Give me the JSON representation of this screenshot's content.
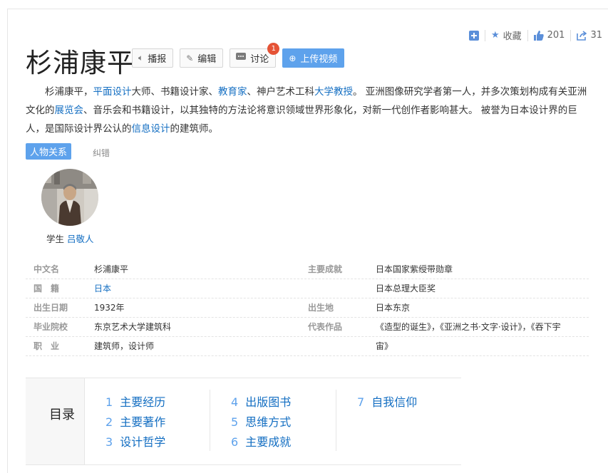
{
  "actions": {
    "collect_label": "收藏",
    "like_count": "201",
    "share_count": "31"
  },
  "title": "杉浦康平",
  "buttons": {
    "report": "播报",
    "edit": "编辑",
    "discuss": "讨论",
    "discuss_badge": "1",
    "upload": "上传视频"
  },
  "summary": {
    "p1": "杉浦康平，",
    "link1": "平面设计",
    "p2": "大师、书籍设计家、",
    "link2": "教育家",
    "p3": "、神户艺术工科",
    "link3": "大学教授",
    "p4": "。 亚洲图像研究学者第一人，并多次策划构成有关亚洲文化的",
    "link4": "展览会",
    "p5": "、音乐会和书籍设计，以其独特的方法论将意识领域世界形象化，对新一代创作者影响甚大。 被誉为日本设计界的巨人，是国际设计界公认的",
    "link5": "信息设计",
    "p6": "的建筑师。"
  },
  "relations": {
    "tab_label": "人物关系",
    "correct_label": "纠错",
    "person_role": "学生",
    "person_name": "吕敬人"
  },
  "info": {
    "rows": [
      {
        "k1": "中文名",
        "v1": "杉浦康平",
        "k2": "主要成就",
        "v2": "日本国家紫绶带勋章"
      },
      {
        "k1": "国　籍",
        "v1": "日本",
        "k2": "",
        "v2": "日本总理大臣奖"
      },
      {
        "k1": "出生日期",
        "v1": "1932年",
        "k2": "出生地",
        "v2": "日本东京"
      },
      {
        "k1": "毕业院校",
        "v1": "东京艺术大学建筑科",
        "k2": "代表作品",
        "v2": "《造型的诞生》，《亚洲之书·文字·设计》，《吞下宇"
      },
      {
        "k1": "职　业",
        "v1": "建筑师，设计师",
        "k2": "",
        "v2": "宙》"
      }
    ]
  },
  "toc": {
    "title": "目录",
    "items": [
      {
        "num": "1",
        "label": "主要经历"
      },
      {
        "num": "2",
        "label": "主要著作"
      },
      {
        "num": "3",
        "label": "设计哲学"
      },
      {
        "num": "4",
        "label": "出版图书"
      },
      {
        "num": "5",
        "label": "思维方式"
      },
      {
        "num": "6",
        "label": "主要成就"
      },
      {
        "num": "7",
        "label": "自我信仰"
      }
    ]
  },
  "colors": {
    "link": "#136ec2",
    "accent": "#5ea2ec",
    "badge": "#e55336"
  }
}
